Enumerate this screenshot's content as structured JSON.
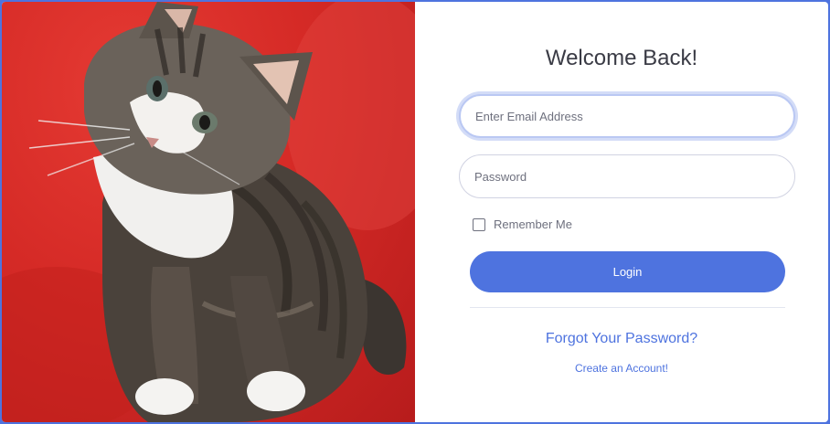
{
  "login": {
    "title": "Welcome Back!",
    "email_placeholder": "Enter Email Address",
    "password_placeholder": "Password",
    "remember_label": "Remember Me",
    "login_button": "Login",
    "forgot_link": "Forgot Your Password?",
    "create_link": "Create an Account!"
  },
  "colors": {
    "accent": "#4e73df",
    "background_red": "#d52a26",
    "text": "#3a3b45",
    "muted": "#6e707e"
  },
  "image": {
    "subject": "kitten"
  }
}
